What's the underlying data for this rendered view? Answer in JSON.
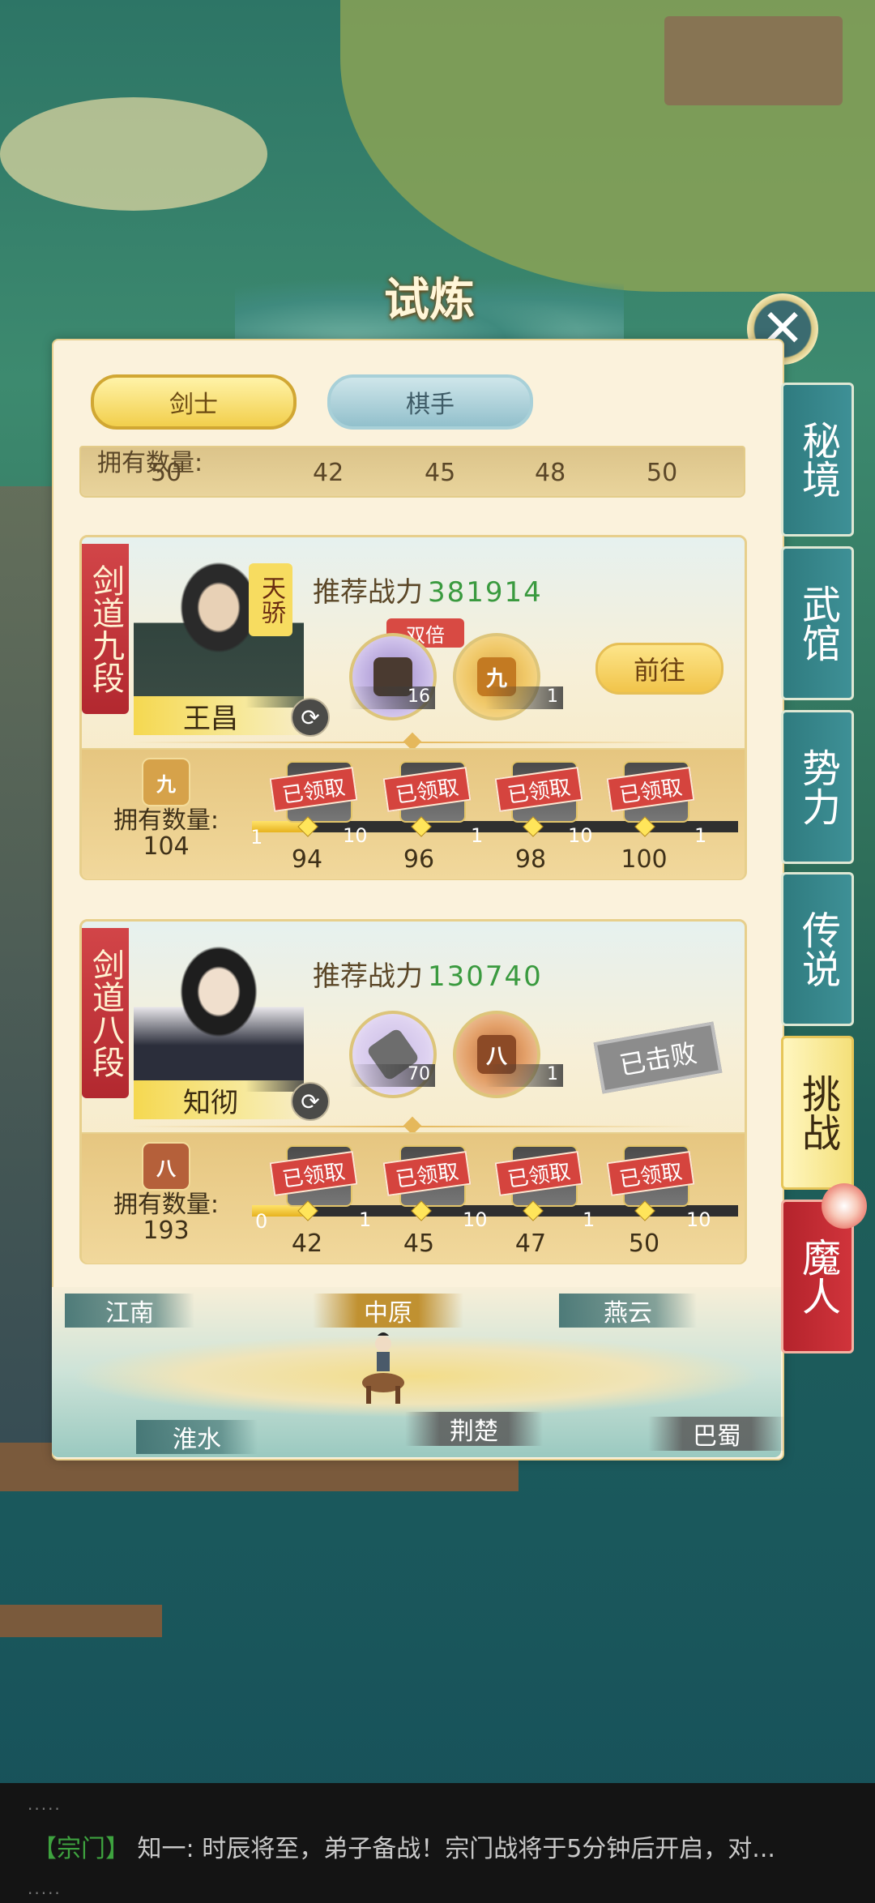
{
  "title": "试炼",
  "tabs": [
    {
      "label": "剑士",
      "active": true
    },
    {
      "label": "棋手",
      "active": false
    }
  ],
  "prev_strip": {
    "own_label": "拥有数量:",
    "own_count": "50",
    "milestones": [
      "42",
      "45",
      "48",
      "50"
    ]
  },
  "cards": [
    {
      "rank": "剑道九段",
      "name": "王昌",
      "tag": "天骄",
      "power_label": "推荐战力",
      "power_value": "381914",
      "double_label": "双倍",
      "items": [
        {
          "icon": "treasure-chest-icon",
          "count": "16"
        },
        {
          "icon": "rank-nine-medal-icon",
          "glyph": "九",
          "count": "1"
        }
      ],
      "action_label": "前往",
      "own_label": "拥有数量:",
      "own_icon_glyph": "九",
      "own_count": "104",
      "progress": 0.12,
      "rewards": [
        {
          "claimed_label": "已领取",
          "count": "10"
        },
        {
          "claimed_label": "已领取",
          "count": "1"
        },
        {
          "claimed_label": "已领取",
          "count": "10"
        },
        {
          "claimed_label": "已领取",
          "count": "1"
        }
      ],
      "reward_left_counts": [
        "1",
        "",
        "",
        ""
      ],
      "milestones": [
        "94",
        "96",
        "98",
        "100"
      ]
    },
    {
      "rank": "剑道八段",
      "name": "知彻",
      "power_label": "推荐战力",
      "power_value": "130740",
      "items": [
        {
          "icon": "sword-icon",
          "count": "70"
        },
        {
          "icon": "rank-eight-medal-icon",
          "glyph": "八",
          "count": "1"
        }
      ],
      "action_label": "已击败",
      "own_label": "拥有数量:",
      "own_icon_glyph": "八",
      "own_count": "193",
      "progress": 0.12,
      "rewards": [
        {
          "claimed_label": "已领取",
          "count": "1"
        },
        {
          "claimed_label": "已领取",
          "count": "10"
        },
        {
          "claimed_label": "已领取",
          "count": "1"
        },
        {
          "claimed_label": "已领取",
          "count": "10"
        }
      ],
      "reward_left_counts": [
        "0",
        "",
        "",
        ""
      ],
      "milestones": [
        "42",
        "45",
        "47",
        "50"
      ]
    }
  ],
  "regions": [
    {
      "label": "江南",
      "state": "normal"
    },
    {
      "label": "中原",
      "state": "active"
    },
    {
      "label": "燕云",
      "state": "normal"
    },
    {
      "label": "淮水",
      "state": "normal"
    },
    {
      "label": "荆楚",
      "state": "grey"
    },
    {
      "label": "巴蜀",
      "state": "grey"
    }
  ],
  "side_tabs": [
    {
      "label": "秘境"
    },
    {
      "label": "武馆"
    },
    {
      "label": "势力"
    },
    {
      "label": "传说"
    },
    {
      "label": "挑战",
      "active": true
    },
    {
      "label": "魔人"
    }
  ],
  "chat": {
    "channel": "【宗门】",
    "message": "知一: 时辰将至，弟子备战！宗门战将于5分钟后开启，对...",
    "dots": "....."
  }
}
